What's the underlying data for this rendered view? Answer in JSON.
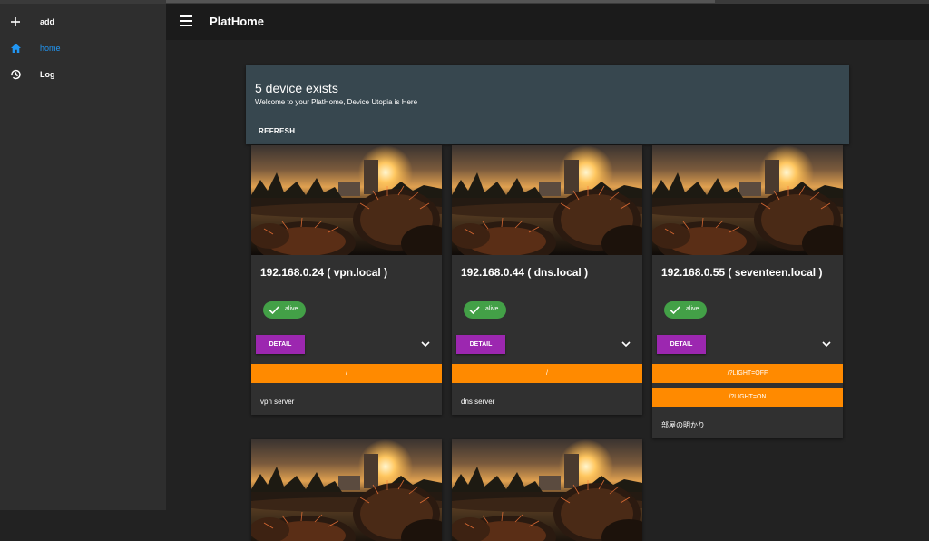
{
  "app": {
    "title": "PlatHome"
  },
  "sidebar": {
    "items": [
      {
        "label": "add",
        "icon": "plus-icon",
        "active": false
      },
      {
        "label": "home",
        "icon": "home-icon",
        "active": true
      },
      {
        "label": "Log",
        "icon": "history-icon",
        "active": false
      }
    ]
  },
  "banner": {
    "title": "5 device exists",
    "subtitle": "Welcome to your PlatHome, Device Utopia is Here",
    "refresh_label": "REFRESH"
  },
  "devices": [
    {
      "title": "192.168.0.24 ( vpn.local )",
      "status": "alive",
      "detail_label": "DETAIL",
      "actions": [
        "/"
      ],
      "description": "vpn server"
    },
    {
      "title": "192.168.0.44 ( dns.local )",
      "status": "alive",
      "detail_label": "DETAIL",
      "actions": [
        "/"
      ],
      "description": "dns server"
    },
    {
      "title": "192.168.0.55 ( seventeen.local )",
      "status": "alive",
      "detail_label": "DETAIL",
      "actions": [
        "/?LIGHT=OFF",
        "/?LIGHT=ON"
      ],
      "description": "部屋の明かり"
    }
  ],
  "colors": {
    "accent": "#2196f3",
    "banner": "#37474f",
    "status_alive": "#43a047",
    "detail_button": "#9c27b0",
    "action_button": "#ff8a00"
  }
}
